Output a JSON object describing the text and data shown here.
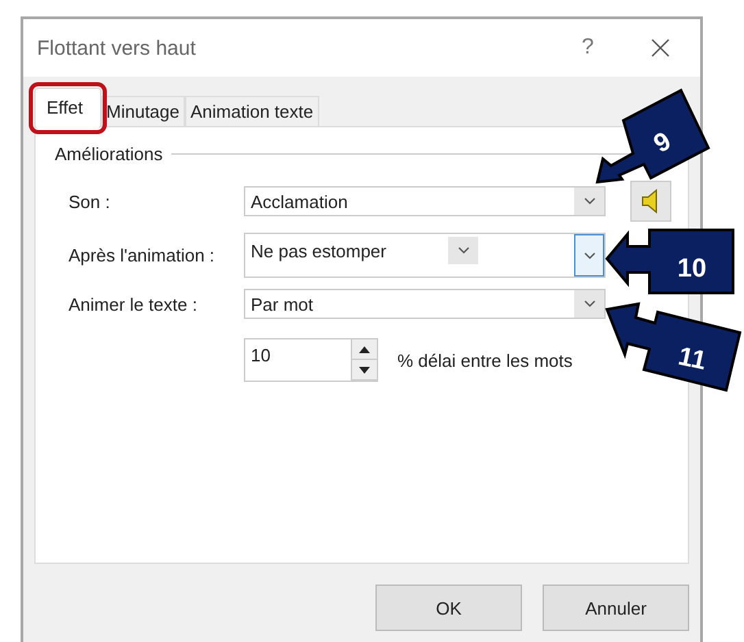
{
  "window": {
    "title": "Flottant vers haut",
    "help": "?"
  },
  "tabs": [
    {
      "label": "Effet",
      "selected": true,
      "highlighted": true
    },
    {
      "label": "Minutage",
      "selected": false,
      "highlighted": false
    },
    {
      "label": "Animation texte",
      "selected": false,
      "highlighted": false
    }
  ],
  "group": {
    "title": "Améliorations"
  },
  "fields": [
    {
      "kind": "combo",
      "label": "Son :",
      "value": "Acclamation",
      "focused": false,
      "sound_button": true
    },
    {
      "kind": "combo_split",
      "label": "Après l'animation :",
      "value": "Ne pas estomper",
      "focused": true
    },
    {
      "kind": "combo",
      "label": "Animer le texte :",
      "value": "Par mot",
      "focused": false
    },
    {
      "kind": "spinner",
      "value": "10",
      "suffix": "% délai entre les mots"
    }
  ],
  "buttons": [
    "OK",
    "Annuler"
  ],
  "callouts": [
    "9",
    "10",
    "11"
  ]
}
